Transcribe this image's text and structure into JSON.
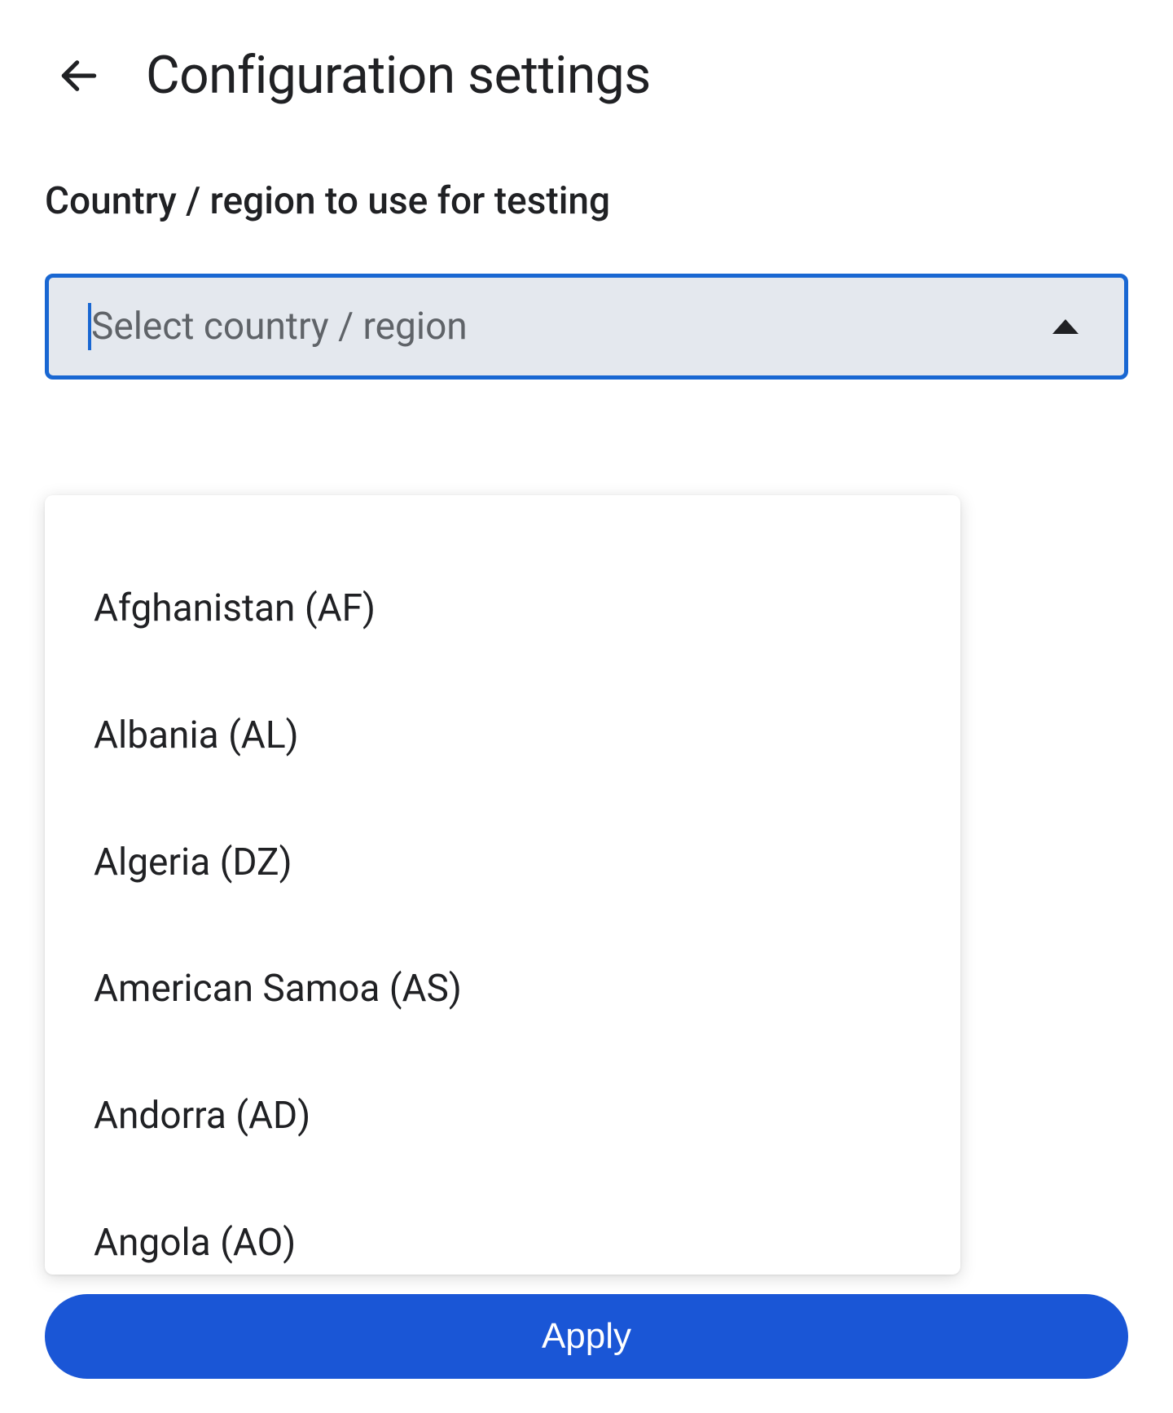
{
  "header": {
    "title": "Configuration settings"
  },
  "field": {
    "label": "Country / region to use for testing",
    "placeholder": "Select country / region"
  },
  "dropdown": {
    "items": [
      "Afghanistan (AF)",
      "Albania (AL)",
      "Algeria (DZ)",
      "American Samoa (AS)",
      "Andorra (AD)",
      "Angola (AO)"
    ]
  },
  "actions": {
    "apply_label": "Apply"
  }
}
